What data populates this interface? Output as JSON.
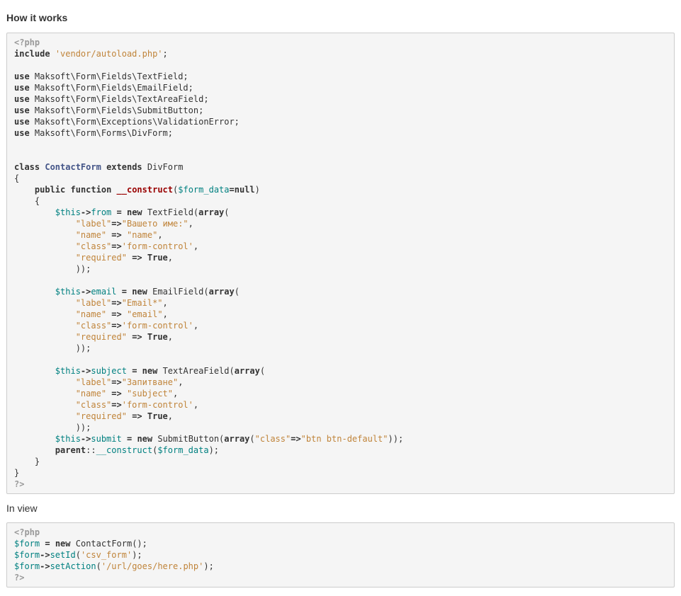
{
  "headings": {
    "how_it_works": "How it works",
    "in_view": "In view"
  },
  "colors": {
    "code_background": "#f5f5f5",
    "code_border": "#cccccc",
    "string": "#c0843a",
    "variable": "#008080",
    "class_name": "#445588",
    "function_name": "#990000",
    "php_tag": "#999999"
  },
  "code_main": [
    [
      [
        "php-tag",
        "<?php"
      ]
    ],
    [
      [
        "kw",
        "include"
      ],
      [
        "plain",
        " "
      ],
      [
        "str",
        "'vendor/autoload.php'"
      ],
      [
        "plain",
        ";"
      ]
    ],
    [],
    [
      [
        "kw",
        "use"
      ],
      [
        "plain",
        " Maksoft\\Form\\Fields\\TextField;"
      ]
    ],
    [
      [
        "kw",
        "use"
      ],
      [
        "plain",
        " Maksoft\\Form\\Fields\\EmailField;"
      ]
    ],
    [
      [
        "kw",
        "use"
      ],
      [
        "plain",
        " Maksoft\\Form\\Fields\\TextAreaField;"
      ]
    ],
    [
      [
        "kw",
        "use"
      ],
      [
        "plain",
        " Maksoft\\Form\\Fields\\SubmitButton;"
      ]
    ],
    [
      [
        "kw",
        "use"
      ],
      [
        "plain",
        " Maksoft\\Form\\Exceptions\\ValidationError;"
      ]
    ],
    [
      [
        "kw",
        "use"
      ],
      [
        "plain",
        " Maksoft\\Form\\Forms\\DivForm;"
      ]
    ],
    [],
    [],
    [
      [
        "kw",
        "class"
      ],
      [
        "plain",
        " "
      ],
      [
        "cls",
        "ContactForm"
      ],
      [
        "plain",
        " "
      ],
      [
        "kw",
        "extends"
      ],
      [
        "plain",
        " DivForm"
      ]
    ],
    [
      [
        "plain",
        "{"
      ]
    ],
    [
      [
        "plain",
        "    "
      ],
      [
        "kw",
        "public"
      ],
      [
        "plain",
        " "
      ],
      [
        "kw",
        "function"
      ],
      [
        "plain",
        " "
      ],
      [
        "fn",
        "__construct"
      ],
      [
        "plain",
        "("
      ],
      [
        "var",
        "$form_data"
      ],
      [
        "kw",
        "=null"
      ],
      [
        "plain",
        ")"
      ]
    ],
    [
      [
        "plain",
        "    {"
      ]
    ],
    [
      [
        "plain",
        "        "
      ],
      [
        "var",
        "$this"
      ],
      [
        "kw",
        "->"
      ],
      [
        "prop",
        "from"
      ],
      [
        "plain",
        " "
      ],
      [
        "kw",
        "="
      ],
      [
        "plain",
        " "
      ],
      [
        "kw",
        "new"
      ],
      [
        "plain",
        " TextField("
      ],
      [
        "kw",
        "array"
      ],
      [
        "plain",
        "("
      ]
    ],
    [
      [
        "plain",
        "            "
      ],
      [
        "str",
        "\"label\""
      ],
      [
        "kw",
        "=>"
      ],
      [
        "str",
        "\"Вашето име:\""
      ],
      [
        "plain",
        ","
      ]
    ],
    [
      [
        "plain",
        "            "
      ],
      [
        "str",
        "\"name\""
      ],
      [
        "plain",
        " "
      ],
      [
        "kw",
        "=>"
      ],
      [
        "plain",
        " "
      ],
      [
        "str",
        "\"name\""
      ],
      [
        "plain",
        ","
      ]
    ],
    [
      [
        "plain",
        "            "
      ],
      [
        "str",
        "\"class\""
      ],
      [
        "kw",
        "=>"
      ],
      [
        "str",
        "'form-control'"
      ],
      [
        "plain",
        ","
      ]
    ],
    [
      [
        "plain",
        "            "
      ],
      [
        "str",
        "\"required\""
      ],
      [
        "plain",
        " "
      ],
      [
        "kw",
        "=>"
      ],
      [
        "plain",
        " "
      ],
      [
        "kw",
        "True"
      ],
      [
        "plain",
        ","
      ]
    ],
    [
      [
        "plain",
        "            ));"
      ]
    ],
    [],
    [
      [
        "plain",
        "        "
      ],
      [
        "var",
        "$this"
      ],
      [
        "kw",
        "->"
      ],
      [
        "prop",
        "email"
      ],
      [
        "plain",
        " "
      ],
      [
        "kw",
        "="
      ],
      [
        "plain",
        " "
      ],
      [
        "kw",
        "new"
      ],
      [
        "plain",
        " EmailField("
      ],
      [
        "kw",
        "array"
      ],
      [
        "plain",
        "("
      ]
    ],
    [
      [
        "plain",
        "            "
      ],
      [
        "str",
        "\"label\""
      ],
      [
        "kw",
        "=>"
      ],
      [
        "str",
        "\"Email*\""
      ],
      [
        "plain",
        ","
      ]
    ],
    [
      [
        "plain",
        "            "
      ],
      [
        "str",
        "\"name\""
      ],
      [
        "plain",
        " "
      ],
      [
        "kw",
        "=>"
      ],
      [
        "plain",
        " "
      ],
      [
        "str",
        "\"email\""
      ],
      [
        "plain",
        ","
      ]
    ],
    [
      [
        "plain",
        "            "
      ],
      [
        "str",
        "\"class\""
      ],
      [
        "kw",
        "=>"
      ],
      [
        "str",
        "'form-control'"
      ],
      [
        "plain",
        ","
      ]
    ],
    [
      [
        "plain",
        "            "
      ],
      [
        "str",
        "\"required\""
      ],
      [
        "plain",
        " "
      ],
      [
        "kw",
        "=>"
      ],
      [
        "plain",
        " "
      ],
      [
        "kw",
        "True"
      ],
      [
        "plain",
        ","
      ]
    ],
    [
      [
        "plain",
        "            ));"
      ]
    ],
    [],
    [
      [
        "plain",
        "        "
      ],
      [
        "var",
        "$this"
      ],
      [
        "kw",
        "->"
      ],
      [
        "prop",
        "subject"
      ],
      [
        "plain",
        " "
      ],
      [
        "kw",
        "="
      ],
      [
        "plain",
        " "
      ],
      [
        "kw",
        "new"
      ],
      [
        "plain",
        " TextAreaField("
      ],
      [
        "kw",
        "array"
      ],
      [
        "plain",
        "("
      ]
    ],
    [
      [
        "plain",
        "            "
      ],
      [
        "str",
        "\"label\""
      ],
      [
        "kw",
        "=>"
      ],
      [
        "str",
        "\"Запитване\""
      ],
      [
        "plain",
        ","
      ]
    ],
    [
      [
        "plain",
        "            "
      ],
      [
        "str",
        "\"name\""
      ],
      [
        "plain",
        " "
      ],
      [
        "kw",
        "=>"
      ],
      [
        "plain",
        " "
      ],
      [
        "str",
        "\"subject\""
      ],
      [
        "plain",
        ","
      ]
    ],
    [
      [
        "plain",
        "            "
      ],
      [
        "str",
        "\"class\""
      ],
      [
        "kw",
        "=>"
      ],
      [
        "str",
        "'form-control'"
      ],
      [
        "plain",
        ","
      ]
    ],
    [
      [
        "plain",
        "            "
      ],
      [
        "str",
        "\"required\""
      ],
      [
        "plain",
        " "
      ],
      [
        "kw",
        "=>"
      ],
      [
        "plain",
        " "
      ],
      [
        "kw",
        "True"
      ],
      [
        "plain",
        ","
      ]
    ],
    [
      [
        "plain",
        "            ));"
      ]
    ],
    [
      [
        "plain",
        "        "
      ],
      [
        "var",
        "$this"
      ],
      [
        "kw",
        "->"
      ],
      [
        "prop",
        "submit"
      ],
      [
        "plain",
        " "
      ],
      [
        "kw",
        "="
      ],
      [
        "plain",
        " "
      ],
      [
        "kw",
        "new"
      ],
      [
        "plain",
        " SubmitButton("
      ],
      [
        "kw",
        "array"
      ],
      [
        "plain",
        "("
      ],
      [
        "str",
        "\"class\""
      ],
      [
        "kw",
        "=>"
      ],
      [
        "str",
        "\"btn btn-default\""
      ],
      [
        "plain",
        "));"
      ]
    ],
    [
      [
        "plain",
        "        "
      ],
      [
        "kw",
        "parent"
      ],
      [
        "plain",
        "::"
      ],
      [
        "prop",
        "__construct"
      ],
      [
        "plain",
        "("
      ],
      [
        "var",
        "$form_data"
      ],
      [
        "plain",
        ");"
      ]
    ],
    [
      [
        "plain",
        "    }"
      ]
    ],
    [
      [
        "plain",
        "}"
      ]
    ],
    [
      [
        "php-tag",
        "?>"
      ]
    ]
  ],
  "code_view": [
    [
      [
        "php-tag",
        "<?php"
      ]
    ],
    [
      [
        "var",
        "$form"
      ],
      [
        "plain",
        " "
      ],
      [
        "kw",
        "="
      ],
      [
        "plain",
        " "
      ],
      [
        "kw",
        "new"
      ],
      [
        "plain",
        " ContactForm();"
      ]
    ],
    [
      [
        "var",
        "$form"
      ],
      [
        "kw",
        "->"
      ],
      [
        "prop",
        "setId"
      ],
      [
        "plain",
        "("
      ],
      [
        "str",
        "'csv_form'"
      ],
      [
        "plain",
        ");"
      ]
    ],
    [
      [
        "var",
        "$form"
      ],
      [
        "kw",
        "->"
      ],
      [
        "prop",
        "setAction"
      ],
      [
        "plain",
        "("
      ],
      [
        "str",
        "'/url/goes/here.php'"
      ],
      [
        "plain",
        ");"
      ]
    ],
    [
      [
        "php-tag",
        "?>"
      ]
    ]
  ]
}
